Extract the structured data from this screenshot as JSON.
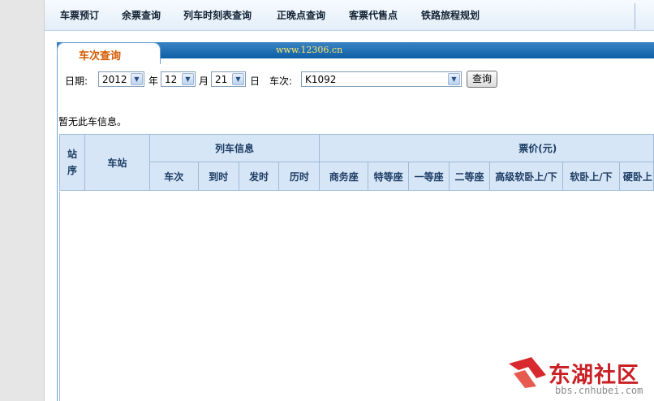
{
  "nav": {
    "items": [
      "车票预订",
      "余票查询",
      "列车时刻表查询",
      "正晚点查询",
      "客票代售点",
      "铁路旅程规划"
    ]
  },
  "panel": {
    "tab_title": "车次查询",
    "site_url": "www.12306.cn"
  },
  "form": {
    "date_label": "日期:",
    "year": "2012",
    "year_unit": "年",
    "month": "12",
    "month_unit": "月",
    "day": "21",
    "day_unit": "日",
    "train_label": "车次:",
    "train_value": "K1092",
    "query_button": "查询"
  },
  "message": "暂无此车信息。",
  "table": {
    "station_order": "站序",
    "station": "车站",
    "train_info_group": "列车信息",
    "price_group": "票价(元)",
    "train_info_columns": [
      "车次",
      "到时",
      "发时",
      "历时"
    ],
    "price_columns": [
      "商务座",
      "特等座",
      "一等座",
      "二等座",
      "高级软卧上/下",
      "软卧上/下",
      "硬卧上"
    ]
  },
  "watermark": {
    "brand": "东湖社区",
    "url": "bbs.cnhubei.com"
  },
  "colors": {
    "tab_title": "#d35a00",
    "band": "#0e5ea6",
    "header_bg": "#d6e6f7",
    "watermark_red": "#c92025"
  }
}
